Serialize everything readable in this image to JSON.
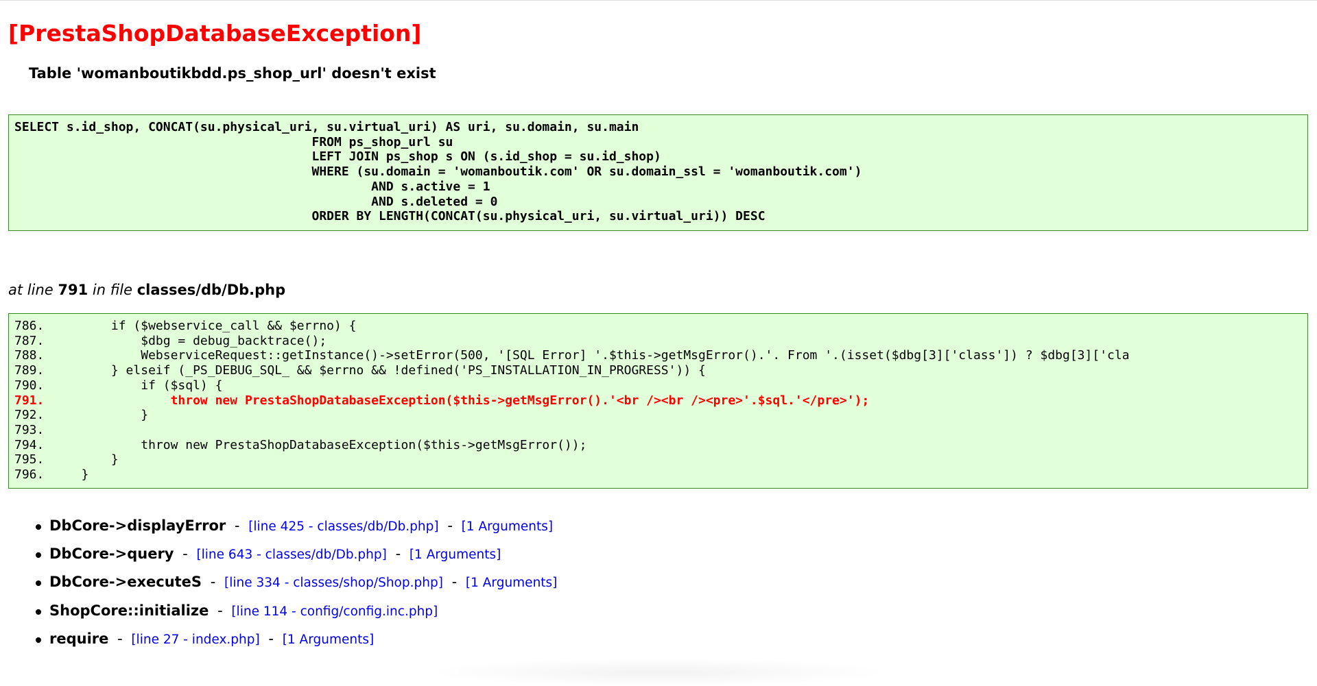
{
  "error": {
    "title": "[PrestaShopDatabaseException]",
    "message": "Table 'womanboutikbdd.ps_shop_url' doesn't exist"
  },
  "sql": {
    "lines": [
      "SELECT s.id_shop, CONCAT(su.physical_uri, su.virtual_uri) AS uri, su.domain, su.main",
      "                                        FROM ps_shop_url su",
      "                                        LEFT JOIN ps_shop s ON (s.id_shop = su.id_shop)",
      "                                        WHERE (su.domain = 'womanboutik.com' OR su.domain_ssl = 'womanboutik.com')",
      "                                                AND s.active = 1",
      "                                                AND s.deleted = 0",
      "                                        ORDER BY LENGTH(CONCAT(su.physical_uri, su.virtual_uri)) DESC"
    ]
  },
  "location": {
    "prefix": "at line",
    "line": "791",
    "middle": "in file",
    "file": "classes/db/Db.php"
  },
  "source": {
    "lines": [
      "786.         if ($webservice_call && $errno) {",
      "787.             $dbg = debug_backtrace();",
      "788.             WebserviceRequest::getInstance()->setError(500, '[SQL Error] '.$this->getMsgError().'. From '.(isset($dbg[3]['class']) ? $dbg[3]['cla",
      "789.         } elseif (_PS_DEBUG_SQL_ && $errno && !defined('PS_INSTALLATION_IN_PROGRESS')) {",
      "790.             if ($sql) {",
      "791.                 throw new PrestaShopDatabaseException($this->getMsgError().'<br /><br /><pre>'.$sql.'</pre>');",
      "792.             }",
      "793.",
      "794.             throw new PrestaShopDatabaseException($this->getMsgError());",
      "795.         }",
      "796.     }"
    ]
  },
  "trace": [
    {
      "fn": "DbCore->displayError",
      "link": "[line 425 - classes/db/Db.php]",
      "args": "[1 Arguments]"
    },
    {
      "fn": "DbCore->query",
      "link": "[line 643 - classes/db/Db.php]",
      "args": "[1 Arguments]"
    },
    {
      "fn": "DbCore->executeS",
      "link": "[line 334 - classes/shop/Shop.php]",
      "args": "[1 Arguments]"
    },
    {
      "fn": "ShopCore::initialize",
      "link": "[line 114 - config/config.inc.php]",
      "args": ""
    },
    {
      "fn": "require",
      "link": "[line 27 - index.php]",
      "args": "[1 Arguments]"
    }
  ],
  "colors": {
    "title": "#ff0000",
    "code_bg": "#e1ffd8",
    "code_border": "#3b8a28",
    "link": "#0000ee"
  }
}
